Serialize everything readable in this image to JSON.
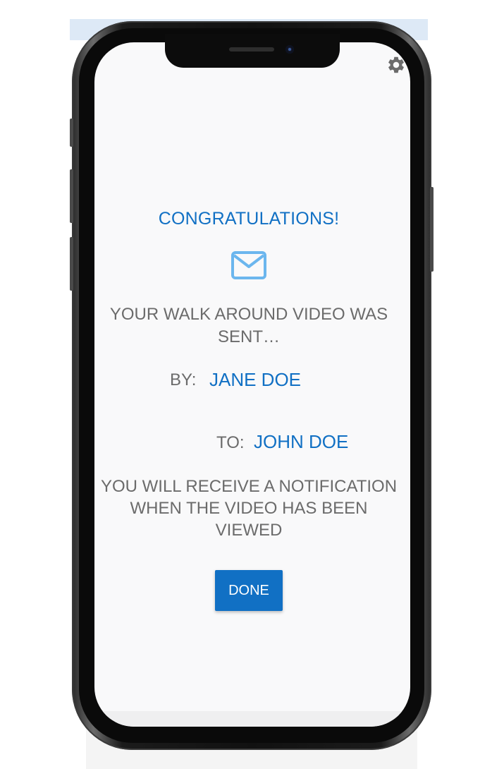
{
  "status": {
    "title": "CONGRATULATIONS!",
    "message": "YOUR WALK AROUND VIDEO WAS SENT…"
  },
  "sender": {
    "label": "BY:",
    "name": "JANE DOE"
  },
  "recipient": {
    "label": "TO:",
    "name": "JOHN DOE"
  },
  "notification": "YOU WILL RECEIVE A NOTIFICATION WHEN THE VIDEO HAS BEEN VIEWED",
  "actions": {
    "done_label": "DONE"
  },
  "icons": {
    "settings": "gear-icon",
    "sent": "envelope-icon"
  },
  "colors": {
    "accent": "#1170c4",
    "text": "#6b6b6b",
    "icon": "#6bb6ee"
  }
}
